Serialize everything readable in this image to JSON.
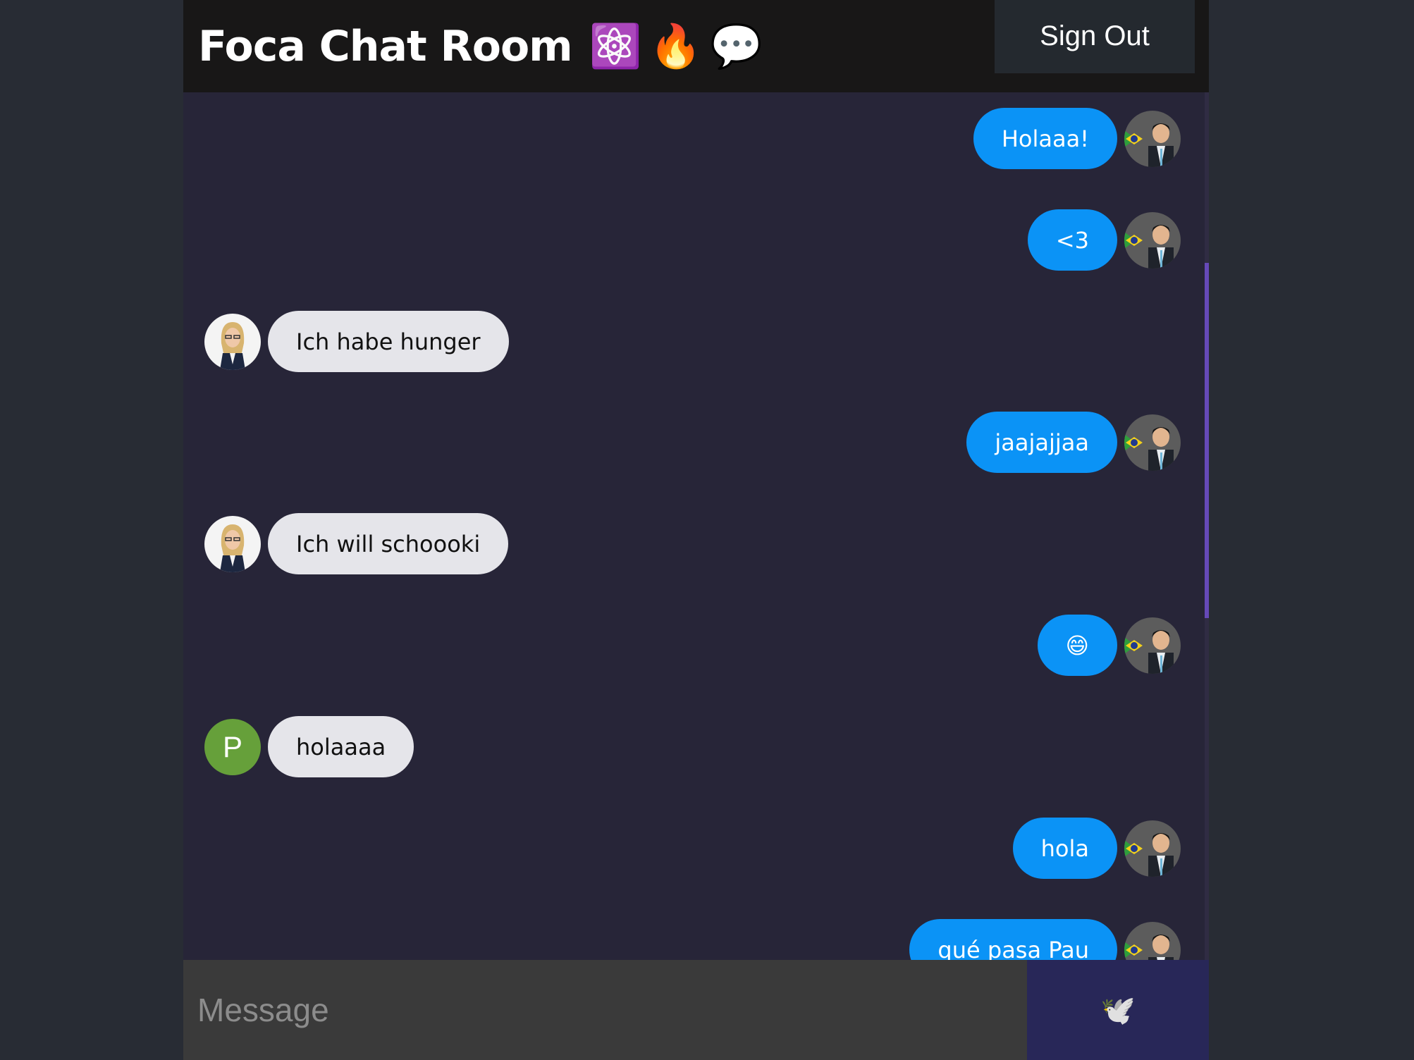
{
  "header": {
    "title": "Foca Chat Room",
    "emojis": [
      "⚛️",
      "🔥",
      "💬"
    ],
    "sign_out_label": "Sign Out"
  },
  "messages": [
    {
      "type": "sent",
      "text": "Holaaa!",
      "avatar": "photo-man"
    },
    {
      "type": "sent",
      "text": "<3",
      "avatar": "photo-man"
    },
    {
      "type": "received",
      "text": "Ich habe hunger",
      "avatar": "photo-woman"
    },
    {
      "type": "sent",
      "text": "jaajajjaa",
      "avatar": "photo-man"
    },
    {
      "type": "received",
      "text": "Ich will schoooki",
      "avatar": "photo-woman"
    },
    {
      "type": "sent",
      "text": "😄",
      "avatar": "photo-man"
    },
    {
      "type": "received",
      "text": "holaaaa",
      "avatar": "letter",
      "avatar_letter": "P"
    },
    {
      "type": "sent",
      "text": "hola",
      "avatar": "photo-man"
    },
    {
      "type": "sent",
      "text": "qué pasa Pau",
      "avatar": "photo-man"
    }
  ],
  "composer": {
    "placeholder": "Message",
    "send_icon": "🕊️"
  },
  "colors": {
    "sent_bubble": "#0b93f6",
    "received_bubble": "#e5e5ea",
    "scrollbar_thumb": "#6649b8"
  }
}
